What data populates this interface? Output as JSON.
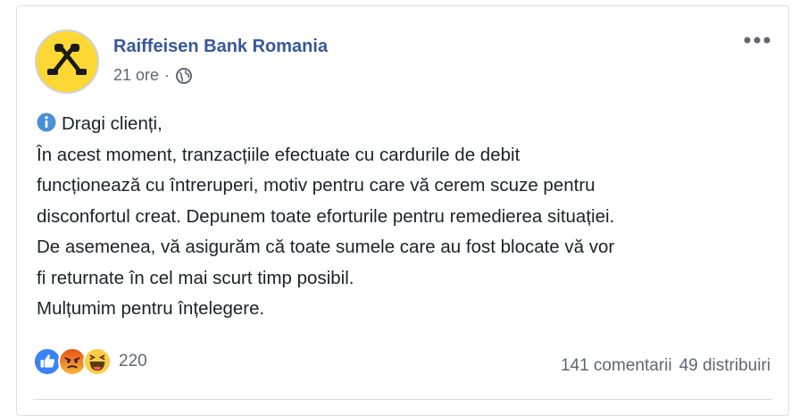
{
  "post": {
    "page_name": "Raiffeisen Bank Romania",
    "time": "21 ore",
    "separator": "·",
    "privacy_icon": "globe-icon",
    "more_icon": "more-options-icon",
    "avatar_icon": "raiffeisen-logo",
    "brand_color": "#fdd835",
    "message": {
      "info_icon": "info-icon",
      "lines": [
        "Dragi clienți,",
        "În acest moment, tranzacțiile efectuate cu cardurile de debit",
        "funcționează cu întreruperi, motiv pentru care vă cerem scuze pentru",
        "disconfortul creat. Depunem toate eforturile pentru remedierea situației.",
        "De asemenea, vă asigurăm că toate sumele care au fost blocate vă vor",
        "fi returnate în cel mai scurt timp posibil.",
        "Mulțumim pentru înțelegere."
      ]
    },
    "reactions": {
      "icons": [
        "like-icon",
        "angry-icon",
        "haha-icon"
      ],
      "count": "220"
    },
    "comments": "141 comentarii",
    "shares": "49 distribuiri"
  }
}
